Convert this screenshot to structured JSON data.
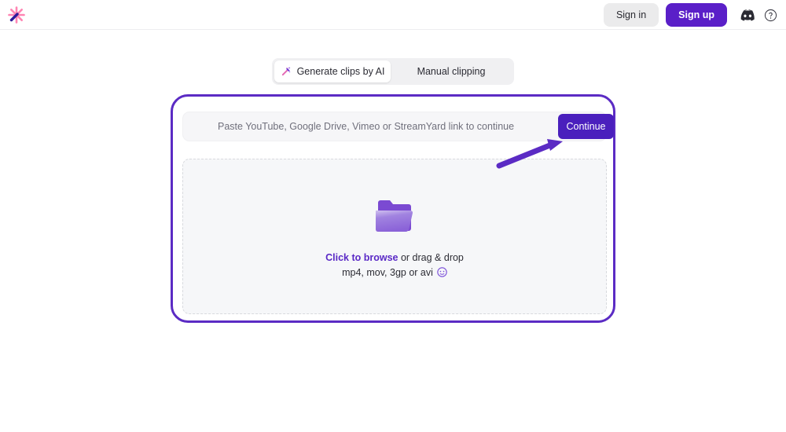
{
  "header": {
    "logo_icon": "magic-wand-sparkle-logo",
    "sign_in_label": "Sign in",
    "sign_up_label": "Sign up",
    "discord_icon": "discord-icon",
    "help_icon": "help-circle-icon"
  },
  "tabs": [
    {
      "label": "Generate clips by AI",
      "icon": "magic-wand-icon",
      "active": true
    },
    {
      "label": "Manual clipping",
      "icon": "",
      "active": false
    }
  ],
  "url_section": {
    "icon": "link-icon",
    "value": "",
    "placeholder": "Paste YouTube, Google Drive, Vimeo or StreamYard link to continue",
    "continue_label": "Continue"
  },
  "dropzone": {
    "icon": "folder-icon",
    "browse_label": "Click to browse",
    "drag_label": " or drag & drop",
    "formats_label": "mp4, mov, 3gp or avi",
    "info_icon": "info-circle-icon"
  },
  "annotation": {
    "arrow": "arrow-pointing-to-continue-button"
  },
  "colors": {
    "brand_purple": "#5a1fc8",
    "continue_purple": "#4a1fbd",
    "highlight_border": "#5b2bc4",
    "logo_pink": "#ff85b3",
    "page_bg": "#ffffff",
    "input_bg": "#f6f6f8",
    "dropzone_bg": "#f6f7f9",
    "tab_track": "#f0f0f2",
    "signin_bg": "#ebebec"
  }
}
